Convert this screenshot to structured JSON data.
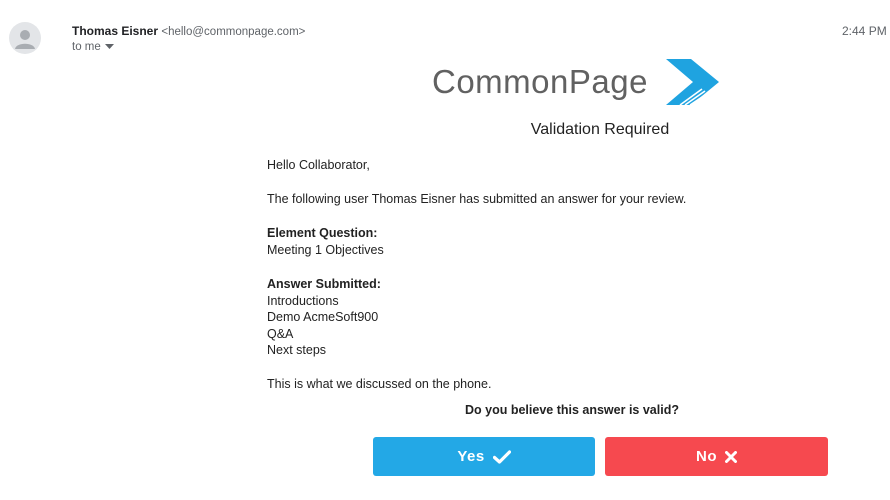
{
  "email": {
    "sender_name": "Thomas Eisner",
    "sender_email": "<hello@commonpage.com>",
    "recipient": "to me",
    "time": "2:44 PM"
  },
  "logo": {
    "text": "CommonPage"
  },
  "heading": "Validation Required",
  "body": {
    "greeting": "Hello Collaborator,",
    "intro": "The following user Thomas Eisner has submitted an answer for your review.",
    "question_label": "Element Question:",
    "question_value": "Meeting 1 Objectives",
    "answer_label": "Answer Submitted:",
    "answer_lines": [
      "Introductions",
      "Demo AcmeSoft900",
      "Q&A",
      "Next steps"
    ],
    "note": "This is what we discussed on the phone."
  },
  "prompt": "Do you believe this answer is valid?",
  "buttons": {
    "yes_label": "Yes",
    "no_label": "No"
  },
  "colors": {
    "yes": "#23a8e6",
    "no": "#f6494f",
    "logo_blue": "#1fa3e0"
  },
  "icons": {
    "avatar": "person-avatar-icon",
    "recipient_menu": "caret-down-icon",
    "yes": "checkmark-icon",
    "no": "x-icon"
  }
}
